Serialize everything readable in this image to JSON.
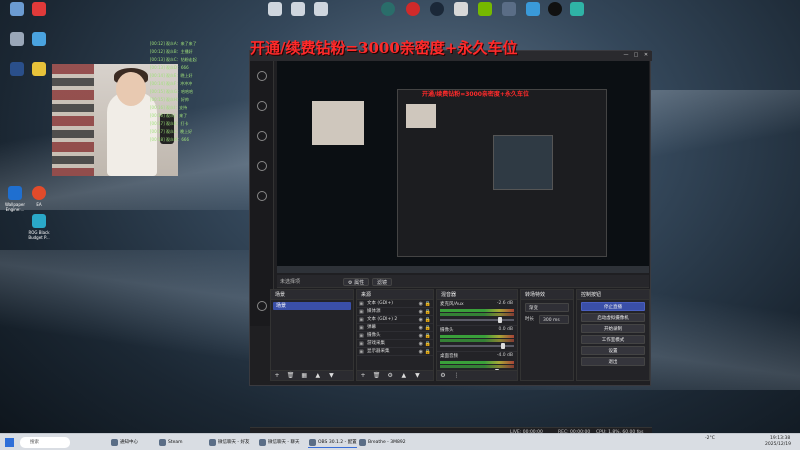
{
  "banner_text": "开通/续费钻粉=3000亲密度+永久车位",
  "nested_banner_text": "开通/续费钻粉=3000亲密度+永久车位",
  "desktop": {
    "top_icons": [
      "",
      "",
      "",
      "",
      "",
      "",
      "",
      "",
      "",
      "",
      "",
      "",
      ""
    ],
    "left_icons": [
      {
        "label": "Wallpaper Engine:..."
      },
      {
        "label": "EA"
      },
      {
        "label": "ROG Black Budget P..."
      }
    ]
  },
  "chat_lines": [
    "[00:12] 观众A：来了来了",
    "[00:12] 观众B：主播好",
    "[00:13] 观众C：钻粉走起",
    "[00:13] 观众D：666",
    "[00:14] 观众E：晚上好",
    "[00:14] 观众F：冲冲冲",
    "[00:15] 观众G：哈哈哈",
    "[00:15] 观众H：好帅",
    "[00:16] 观众I：支持",
    "[00:16] 观众J：来了",
    "[00:17] 观众K：打卡",
    "[00:17] 观众L：晚上好",
    "[00:18] 观众M：666"
  ],
  "obs": {
    "window_controls": [
      "—",
      "□",
      "✕"
    ],
    "scene_selector": "未选择项",
    "tab_properties": "⚙ 属性",
    "tab_filters": "滤镜",
    "scenes_header": "场景",
    "scenes": [
      "场景"
    ],
    "sources_header": "来源",
    "sources": [
      "文本 (GDI+)",
      "媒体源",
      "文本 (GDI+) 2",
      "弹幕",
      "摄像头",
      "游戏采集",
      "显示器采集"
    ],
    "mixer_header": "混音器",
    "mixer_channels": [
      {
        "name": "麦克风/Aux",
        "db": "-2.6 dB",
        "level": 0.78
      },
      {
        "name": "摄像头",
        "db": "0.0 dB",
        "level": 0.82
      },
      {
        "name": "桌面音频",
        "db": "-4.0 dB",
        "level": 0.74
      }
    ],
    "transitions_header": "转场特效",
    "transition_type": "渐变",
    "duration_label": "时长",
    "duration_value": "300 ms",
    "controls_header": "控制按钮",
    "controls": [
      {
        "label": "停止直播",
        "primary": true
      },
      {
        "label": "启动虚拟摄像机",
        "primary": false
      },
      {
        "label": "开始录制",
        "primary": false
      },
      {
        "label": "工作室模式",
        "primary": false
      },
      {
        "label": "设置",
        "primary": false
      },
      {
        "label": "退出",
        "primary": false
      }
    ],
    "status_live": "LIVE: 00:00:00",
    "status_rec": "REC: 00:00:00",
    "status_cpu": "CPU: 1.8%, 60.00 fps"
  },
  "taskbar": {
    "search_placeholder": "搜索",
    "items": [
      {
        "label": "通知中心",
        "active": false
      },
      {
        "label": "Steam",
        "active": false
      },
      {
        "label": "微信聊天 - 好友",
        "active": false
      },
      {
        "label": "微信聊天 - 聊天",
        "active": false
      },
      {
        "label": "OBS 30.1.2 - 配置",
        "active": true
      },
      {
        "label": "Breathe - 3M892",
        "active": false
      }
    ],
    "weather": "-2°C",
    "time": "19:13:38",
    "date": "2025/12/19"
  },
  "colors": {
    "banner": "#ff2a2a",
    "accent": "#3a4fa8",
    "obs_bg": "#1f1f22"
  }
}
